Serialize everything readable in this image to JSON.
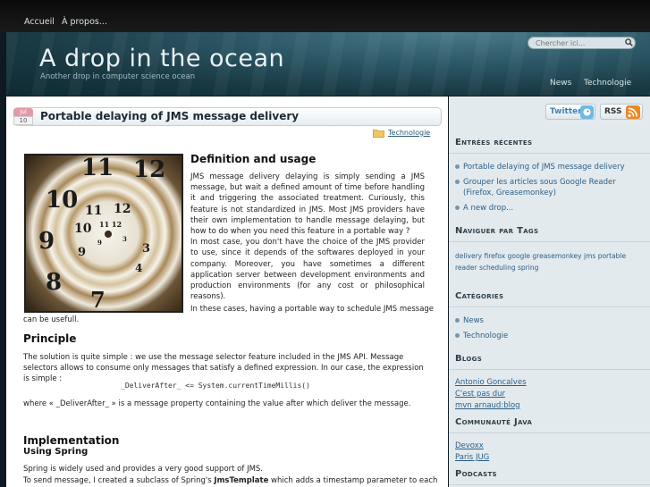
{
  "topnav": {
    "home": "Accueil",
    "about": "À propos..."
  },
  "header": {
    "title": "A drop in the ocean",
    "subtitle": "Another drop in computer science ocean",
    "search_placeholder": "Chercher ici...",
    "nav": [
      "News",
      "Technologie"
    ]
  },
  "post": {
    "date_month": "Jul",
    "date_day": "10",
    "title": "Portable delaying of JMS message delivery",
    "category": "Technologie",
    "definition_heading": "Definition and usage",
    "definition_text": "JMS message delivery delaying is simply sending a JMS message, but wait a defined amount of time before handling it and triggering the associated treatment. Curiously, this feature is not standardized in JMS. Most JMS providers have their own implementation to handle message delaying, but how to do when you need this feature in a portable way ?",
    "definition_text2": "In most case, you don't have the choice of the JMS provider to use, since it depends of the softwares deployed in your company. Moreover, you have sometimes a different application server between development environments and production environments (for any cost or philosophical reasons).",
    "cases_text": "In these cases, having a portable way to schedule JMS message",
    "useful_text": "can be usefull.",
    "principle_heading": "Principle",
    "principle_text": "The solution is quite simple : we use the message selector feature included in the JMS API. Message selectors allows to consume only messages that satisfy a defined expression. In our case, the expression is simple :",
    "code": "_DeliverAfter_ <= System.currentTimeMillis()",
    "where_text": "where « _DeliverAfter_ » is a message property containing the value after which deliver the message.",
    "implementation_heading": "Implementation",
    "spring_heading": "Using Spring",
    "spring_text1": "Spring is widely used and provides a very good support of JMS.",
    "spring_text2_a": "To send message, I created a subclass of Spring's ",
    "spring_text2_b": "JmsTemplate",
    "spring_text2_c": " which adds a timestamp parameter to each"
  },
  "sidebar": {
    "twitter_label": "Twitter",
    "rss_label": "RSS",
    "recent_heading": "Entrées récentes",
    "recent_items": [
      "Portable delaying of JMS message delivery",
      "Grouper les articles sous Google Reader (Firefox, Greasemonkey)",
      "A new drop..."
    ],
    "tags_heading": "Naviguer par Tags",
    "tags": [
      "delivery",
      "firefox",
      "google",
      "greasemonkey",
      "jms",
      "portable",
      "reader",
      "scheduling",
      "spring"
    ],
    "categories_heading": "Catégories",
    "categories": [
      "News",
      "Technologie"
    ],
    "blogs_heading": "Blogs",
    "blogs": [
      "Antonio Goncalves",
      "C'est pas dur",
      "mvn arnaud:blog"
    ],
    "community_heading": "Communauté Java",
    "community": [
      "Devoxx",
      "Paris JUG"
    ],
    "podcasts_heading": "Podcasts"
  },
  "colors": {
    "accent_link": "#2b5f86",
    "header_bg": "#2c5766",
    "sidebar_bg": "#e3eaee",
    "rss_orange": "#f0861f",
    "twitter_blue": "#6fb9e2"
  }
}
